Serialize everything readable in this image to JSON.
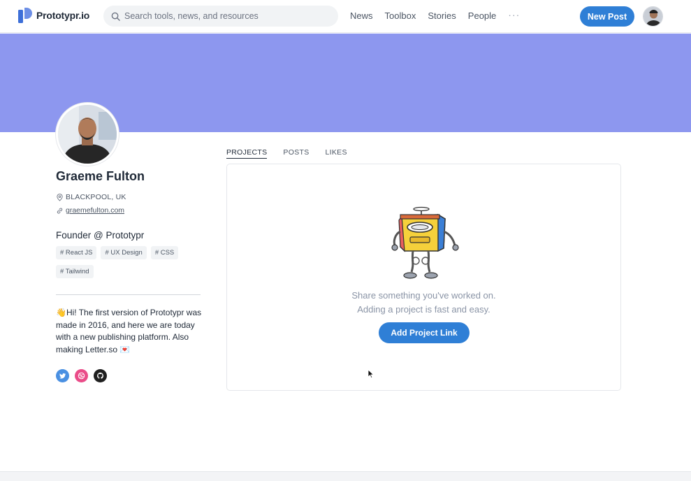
{
  "header": {
    "brand": "Prototypr.io",
    "search_placeholder": "Search tools, news, and resources",
    "nav": [
      "News",
      "Toolbox",
      "Stories",
      "People"
    ],
    "more": "···",
    "new_post": "New Post"
  },
  "colors": {
    "banner": "#8d97ef",
    "accent": "#2f7fd6",
    "logo": "#3d6fd8"
  },
  "profile": {
    "name": "Graeme Fulton",
    "location": "BLACKPOOL, UK",
    "website": "graemefulton.com",
    "role": "Founder @ Prototypr",
    "tags": [
      "# React JS",
      "# UX Design",
      "# CSS",
      "# Tailwind"
    ],
    "bio": "👋Hi! The first version of Prototypr was made in 2016, and here we are today with a new publishing platform. Also making Letter.so 💌",
    "socials": [
      "twitter-icon",
      "dribbble-icon",
      "github-icon"
    ]
  },
  "tabs": [
    "PROJECTS",
    "POSTS",
    "LIKES"
  ],
  "active_tab": "PROJECTS",
  "projects_empty": {
    "line1": "Share something you've worked on.",
    "line2": "Adding a project is fast and easy.",
    "button": "Add Project Link"
  }
}
